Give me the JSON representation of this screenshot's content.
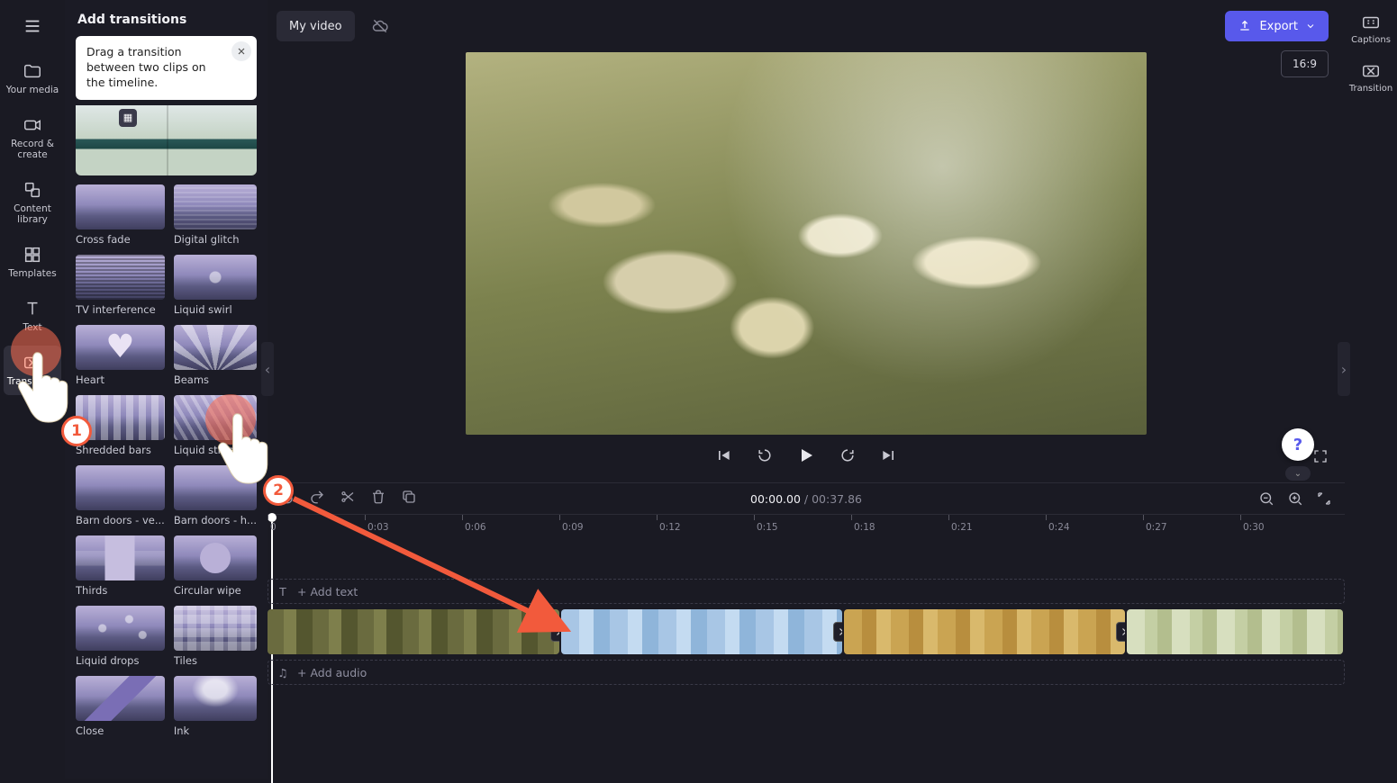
{
  "header": {
    "project_title": "My video",
    "export_label": "Export",
    "aspect_ratio": "16:9"
  },
  "tool_rail": {
    "items": [
      {
        "label": "Your media",
        "icon": "folder-icon"
      },
      {
        "label": "Record & create",
        "icon": "camera-icon"
      },
      {
        "label": "Content library",
        "icon": "library-icon"
      },
      {
        "label": "Templates",
        "icon": "templates-icon"
      },
      {
        "label": "Text",
        "icon": "text-icon"
      },
      {
        "label": "Transitions",
        "icon": "transition-icon"
      }
    ]
  },
  "right_rail": {
    "items": [
      {
        "label": "Captions",
        "icon": "captions-icon"
      },
      {
        "label": "Transition",
        "icon": "transition-icon"
      }
    ]
  },
  "panel": {
    "title": "Add transitions",
    "tip": "Drag a transition between two clips on the timeline.",
    "transitions": [
      {
        "label": "Cross fade",
        "variant": "plain"
      },
      {
        "label": "Digital glitch",
        "variant": "th-glitch"
      },
      {
        "label": "TV interference",
        "variant": "th-tv"
      },
      {
        "label": "Liquid swirl",
        "variant": "th-swirl"
      },
      {
        "label": "Heart",
        "variant": "th-heart"
      },
      {
        "label": "Beams",
        "variant": "th-beams"
      },
      {
        "label": "Shredded bars",
        "variant": "th-bars"
      },
      {
        "label": "Liquid streaks",
        "variant": "th-streaks"
      },
      {
        "label": "Barn doors - ve...",
        "variant": "plain"
      },
      {
        "label": "Barn doors - h...",
        "variant": "plain"
      },
      {
        "label": "Thirds",
        "variant": "th-thirds"
      },
      {
        "label": "Circular wipe",
        "variant": "th-circ"
      },
      {
        "label": "Liquid drops",
        "variant": "th-drops"
      },
      {
        "label": "Tiles",
        "variant": "th-tiles"
      },
      {
        "label": "Close",
        "variant": "th-close"
      },
      {
        "label": "Ink",
        "variant": "th-ink"
      }
    ]
  },
  "playback": {
    "current_time": "00:00.00",
    "duration": "00:37.86"
  },
  "timeline": {
    "ticks": [
      "0",
      "0:03",
      "0:06",
      "0:09",
      "0:12",
      "0:15",
      "0:18",
      "0:21",
      "0:24",
      "0:27",
      "0:30"
    ],
    "add_text_label": "+ Add text",
    "add_audio_label": "+ Add audio"
  },
  "help_label": "?",
  "annotations": {
    "badge1": "1",
    "badge2": "2"
  }
}
